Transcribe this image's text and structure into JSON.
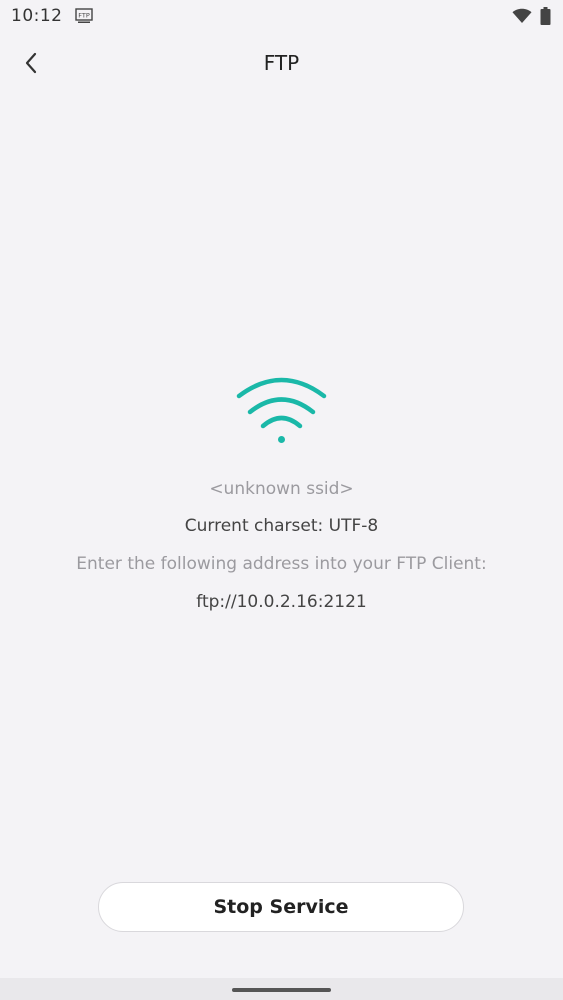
{
  "status_bar": {
    "time": "10:12",
    "notification_icon": "ftp-icon",
    "notification_icon_label": "FTP",
    "wifi_icon": "wifi-icon",
    "battery_icon": "battery-icon"
  },
  "app_bar": {
    "back_icon": "chevron-left-icon",
    "title": "FTP"
  },
  "main": {
    "icon": "wifi-icon",
    "icon_color": "#1ab8a8",
    "ssid": "<unknown ssid>",
    "charset": "Current charset: UTF-8",
    "instruction": "Enter the following address into your FTP Client:",
    "address": "ftp://10.0.2.16:2121"
  },
  "actions": {
    "stop_label": "Stop Service"
  },
  "colors": {
    "background": "#f4f3f6",
    "accent": "#1ab8a8"
  }
}
